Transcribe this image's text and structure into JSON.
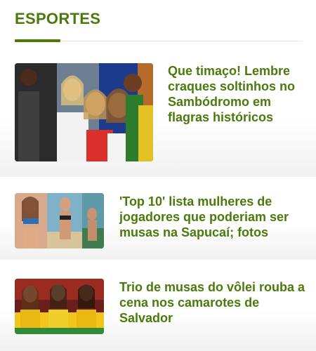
{
  "section": {
    "title": "ESPORTES"
  },
  "colors": {
    "accent": "#4a7a0c",
    "separator": "#e2e2e2"
  },
  "articles": [
    {
      "headline": "Que timaço! Lembre craques soltinhos no Sambódromo em flagras históricos",
      "thumbnail": "carnival-collage-photo"
    },
    {
      "headline": "'Top 10' lista mulheres de jogadores que poderiam ser musas na Sapucaí; fotos",
      "thumbnail": "beach-muses-photo"
    },
    {
      "headline": "Trio de musas do vôlei rouba a cena nos camarotes de Salvador",
      "thumbnail": "volleyball-muses-photo"
    }
  ]
}
